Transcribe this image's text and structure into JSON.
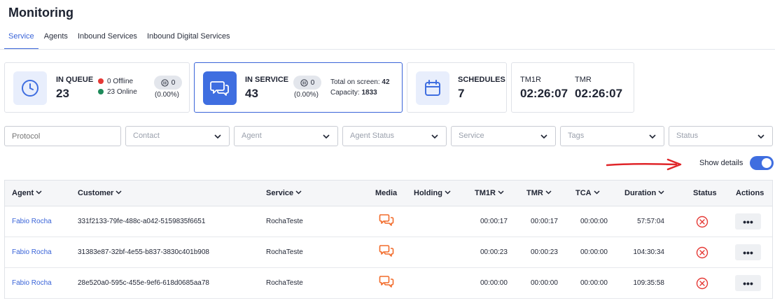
{
  "page": {
    "title": "Monitoring"
  },
  "tabs": [
    {
      "label": "Service",
      "active": true
    },
    {
      "label": "Agents",
      "active": false
    },
    {
      "label": "Inbound Services",
      "active": false
    },
    {
      "label": "Inbound Digital Services",
      "active": false
    }
  ],
  "cards": {
    "in_queue": {
      "label": "IN QUEUE",
      "value": "23",
      "offline": "0 Offline",
      "online": "23 Online",
      "paused": "0",
      "paused_pct": "(0.00%)"
    },
    "in_service": {
      "label": "IN SERVICE",
      "value": "43",
      "paused": "0",
      "paused_pct": "(0.00%)",
      "total_label": "Total on screen:",
      "total_value": "42",
      "capacity_label": "Capacity:",
      "capacity_value": "1833"
    },
    "schedules": {
      "label": "SCHEDULES",
      "value": "7"
    },
    "tm1r": {
      "label": "TM1R",
      "value": "02:26:07"
    },
    "tmr": {
      "label": "TMR",
      "value": "02:26:07"
    }
  },
  "filters": {
    "protocol_placeholder": "Protocol",
    "contact": "Contact",
    "agent": "Agent",
    "agent_status": "Agent Status",
    "service": "Service",
    "tags": "Tags",
    "status": "Status"
  },
  "show_details": {
    "label": "Show details",
    "on": true
  },
  "table": {
    "headers": {
      "agent": "Agent",
      "customer": "Customer",
      "service": "Service",
      "media": "Media",
      "holding": "Holding",
      "tm1r": "TM1R",
      "tmr": "TMR",
      "tca": "TCA",
      "duration": "Duration",
      "status": "Status",
      "actions": "Actions"
    },
    "rows": [
      {
        "agent": "Fabio Rocha",
        "customer": "331f2133-79fe-488c-a042-5159835f6651",
        "service": "RochaTeste",
        "holding": "",
        "tm1r": "00:00:17",
        "tmr": "00:00:17",
        "tca": "00:00:00",
        "duration": "57:57:04"
      },
      {
        "agent": "Fabio Rocha",
        "customer": "31383e87-32bf-4e55-b837-3830c401b908",
        "service": "RochaTeste",
        "holding": "",
        "tm1r": "00:00:23",
        "tmr": "00:00:23",
        "tca": "00:00:00",
        "duration": "104:30:34"
      },
      {
        "agent": "Fabio Rocha",
        "customer": "28e520a0-595c-455e-9ef6-618d0685aa78",
        "service": "RochaTeste",
        "holding": "",
        "tm1r": "00:00:00",
        "tmr": "00:00:00",
        "tca": "00:00:00",
        "duration": "109:35:58"
      }
    ],
    "actions_glyph": "•••"
  },
  "colors": {
    "accent": "#3a64d8",
    "offline_dot": "#e53935",
    "online_dot": "#1e8a5a",
    "media_icon": "#f26b2a",
    "status_icon": "#e53935",
    "annotation_arrow": "#e0262a"
  },
  "icons": {
    "in_queue": "clock-icon",
    "in_service": "chat-bubbles-icon",
    "schedules": "calendar-icon",
    "media": "chat-bubbles-icon",
    "status": "close-circle-icon",
    "sort": "chevron-down-icon"
  }
}
